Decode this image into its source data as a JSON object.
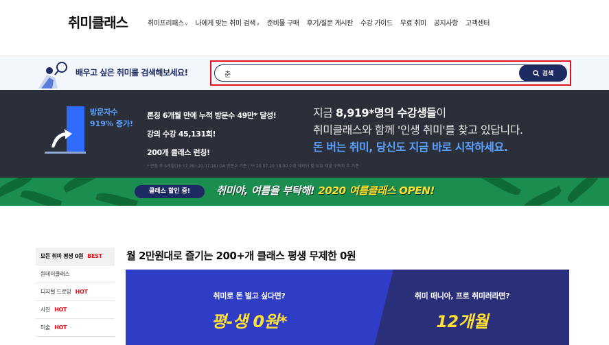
{
  "header": {
    "logo": "취미클래스",
    "nav": [
      {
        "label": "취미프리패스",
        "dropdown": true
      },
      {
        "label": "나에게 맞는 취미 검색",
        "dropdown": true
      },
      {
        "label": "준비물 구매",
        "dropdown": false
      },
      {
        "label": "후기/질문 게시판",
        "dropdown": false
      },
      {
        "label": "수강 가이드",
        "dropdown": false
      },
      {
        "label": "무료 취미",
        "dropdown": false
      },
      {
        "label": "공지사항",
        "dropdown": false
      },
      {
        "label": "고객센터",
        "dropdown": false
      }
    ]
  },
  "search": {
    "prompt": "배우고 싶은 취미를 검색해보세요!",
    "value": "춘",
    "button_label": "검색"
  },
  "stats": {
    "visit_label": "방문자수",
    "visit_value": "919% 증가!",
    "items": [
      "론칭 6개월 만에 누적 방문수 49만* 달성!",
      "강의 수강 45,131회!",
      "200개 클래스 런칭!"
    ],
    "headline_prefix": "지금 ",
    "headline_count": "8,919",
    "headline_suffix": "*명의 수강생들",
    "headline_end": "이",
    "line2": "취미클래스와 함께 '인생 취미'를 찾고 있답니다.",
    "line3": "돈 버는 취미, 당신도 지금 바로 시작하세요.",
    "note": "* 런칭 후 6개월(19.12.26~20.07.16) GA 방문수 기준 / ** 20.07.20 18:00 수강 데이터 및 보유 채널 구독자 수 기준"
  },
  "promo": {
    "pill": "클래스 할인 중!",
    "text_white": "취미야, 여름을 부탁해! ",
    "text_yellow": "2020 여름클래스 OPEN!"
  },
  "sidebar": {
    "items": [
      {
        "label": "모든 취미 평생 0원",
        "badge": "BEST",
        "active": true
      },
      {
        "label": "원데이클래스",
        "badge": "",
        "active": false
      },
      {
        "label": "디지털 드로잉",
        "badge": "HOT",
        "active": false
      },
      {
        "label": "사진",
        "badge": "HOT",
        "active": false
      },
      {
        "label": "미술",
        "badge": "HOT",
        "active": false
      }
    ]
  },
  "main": {
    "title": "월 2만원대로 즐기는 200+개 클래스 평생 무제한 0원",
    "hero_left_sub": "취미로 돈 벌고 싶다면?",
    "hero_left_big": "평-생 0원*",
    "hero_right_sub": "취미 매니아, 프로 취미러라면?",
    "hero_right_big": "12개월"
  },
  "colors": {
    "navy": "#1e2a62",
    "accent_red": "#e0101c",
    "accent_blue": "#5ea2ff",
    "promo_green": "#1b8e4f",
    "highlight_yellow": "#ffe033"
  }
}
